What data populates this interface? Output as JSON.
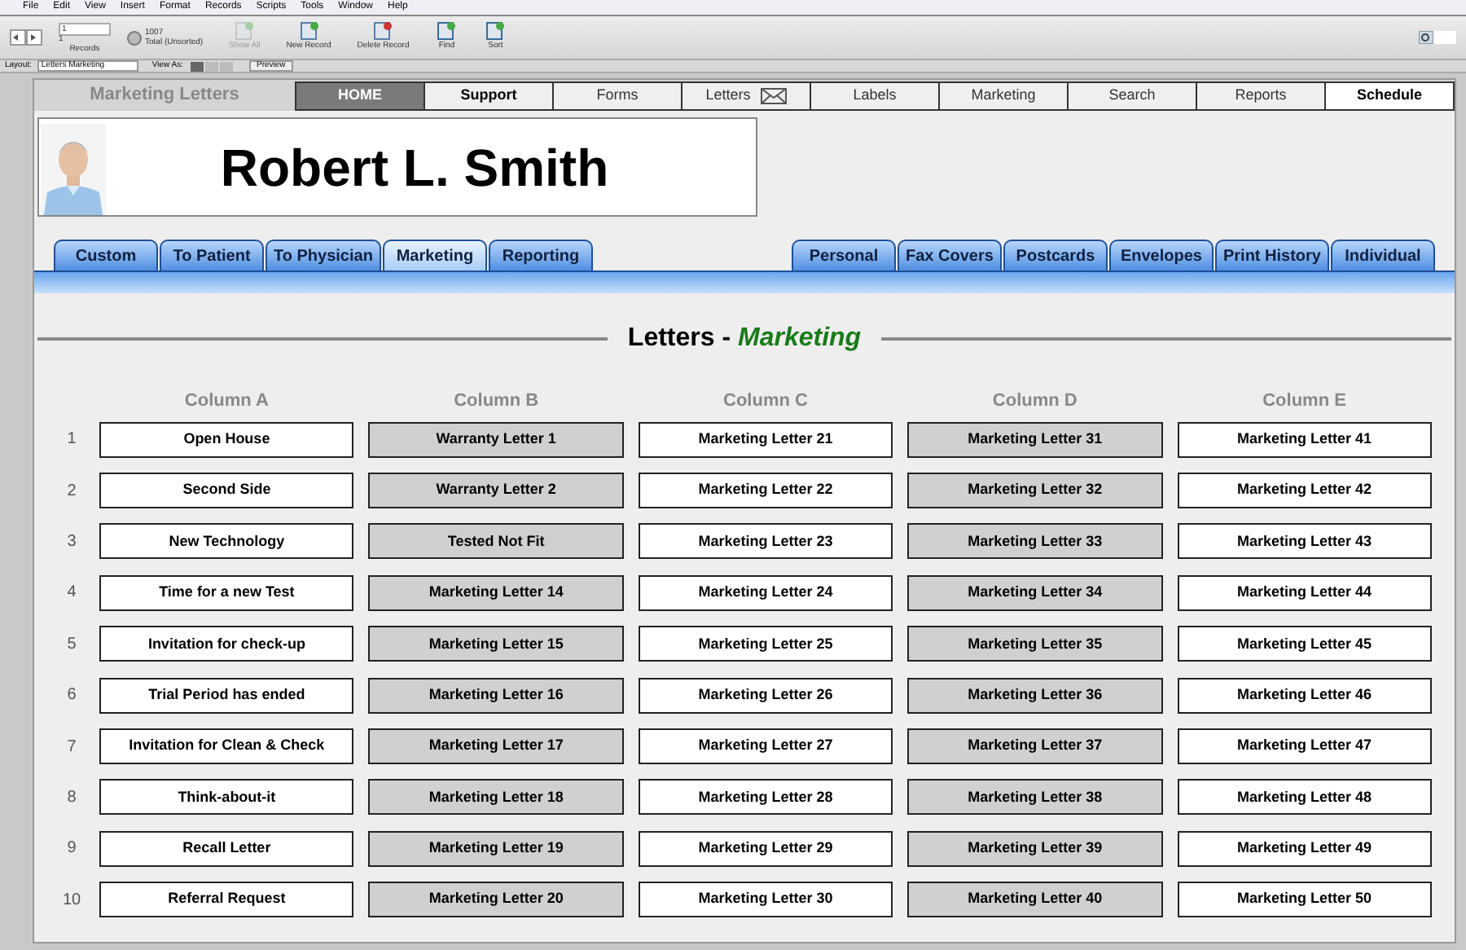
{
  "menu": [
    "File",
    "Edit",
    "View",
    "Insert",
    "Format",
    "Records",
    "Scripts",
    "Tools",
    "Window",
    "Help"
  ],
  "toolbar": {
    "record_field": "1",
    "record_sub": "1",
    "records_label": "Records",
    "total": "1007",
    "total_label": "Total (Unsorted)",
    "buttons": [
      {
        "label": "Show All",
        "disabled": true
      },
      {
        "label": "New Record",
        "disabled": false
      },
      {
        "label": "Delete Record",
        "disabled": false
      },
      {
        "label": "Find",
        "disabled": false
      },
      {
        "label": "Sort",
        "disabled": false
      }
    ]
  },
  "layout_bar": {
    "layout_label": "Layout:",
    "layout_value": "Letters Marketing",
    "view_as_label": "View As:",
    "preview": "Preview"
  },
  "page_title": "Marketing Letters",
  "nav": [
    {
      "label": "HOME",
      "kind": "dark"
    },
    {
      "label": "Support",
      "kind": "bold"
    },
    {
      "label": "Forms",
      "kind": "plain"
    },
    {
      "label": "Letters",
      "kind": "mail"
    },
    {
      "label": "Labels",
      "kind": "plain"
    },
    {
      "label": "Marketing",
      "kind": "plain"
    },
    {
      "label": "Search",
      "kind": "plain"
    },
    {
      "label": "Reports",
      "kind": "plain"
    },
    {
      "label": "Schedule",
      "kind": "white"
    }
  ],
  "patient_name": "Robert L. Smith",
  "tabs_left": [
    {
      "label": "Custom",
      "selected": false
    },
    {
      "label": "To Patient",
      "selected": false
    },
    {
      "label": "To Physician",
      "selected": false
    },
    {
      "label": "Marketing",
      "selected": true
    },
    {
      "label": "Reporting",
      "selected": false
    }
  ],
  "tabs_right": [
    {
      "label": "Personal",
      "selected": false
    },
    {
      "label": "Fax Covers",
      "selected": false
    },
    {
      "label": "Postcards",
      "selected": false
    },
    {
      "label": "Envelopes",
      "selected": false
    },
    {
      "label": "Print History",
      "selected": false
    },
    {
      "label": "Individual",
      "selected": false
    }
  ],
  "heading": {
    "prefix": "Letters -",
    "category": "Marketing"
  },
  "columns": [
    {
      "title": "Column A",
      "shaded": false,
      "items": [
        "Open House",
        "Second Side",
        "New Technology",
        "Time for a new Test",
        "Invitation for check-up",
        "Trial Period has ended",
        "Invitation for Clean & Check",
        "Think-about-it",
        "Recall Letter",
        "Referral Request"
      ]
    },
    {
      "title": "Column B",
      "shaded": true,
      "items": [
        "Warranty Letter 1",
        "Warranty Letter 2",
        "Tested Not Fit",
        "Marketing Letter 14",
        "Marketing Letter 15",
        "Marketing Letter 16",
        "Marketing Letter 17",
        "Marketing Letter 18",
        "Marketing Letter 19",
        "Marketing Letter 20"
      ]
    },
    {
      "title": "Column C",
      "shaded": false,
      "items": [
        "Marketing Letter 21",
        "Marketing Letter 22",
        "Marketing Letter 23",
        "Marketing Letter 24",
        "Marketing Letter 25",
        "Marketing Letter 26",
        "Marketing Letter 27",
        "Marketing Letter 28",
        "Marketing Letter 29",
        "Marketing Letter 30"
      ]
    },
    {
      "title": "Column D",
      "shaded": true,
      "items": [
        "Marketing Letter 31",
        "Marketing Letter 32",
        "Marketing Letter 33",
        "Marketing Letter 34",
        "Marketing Letter 35",
        "Marketing Letter 36",
        "Marketing Letter 37",
        "Marketing Letter 38",
        "Marketing Letter 39",
        "Marketing Letter 40"
      ]
    },
    {
      "title": "Column E",
      "shaded": false,
      "items": [
        "Marketing Letter 41",
        "Marketing Letter 42",
        "Marketing Letter 43",
        "Marketing Letter 44",
        "Marketing Letter 45",
        "Marketing Letter 46",
        "Marketing Letter 47",
        "Marketing Letter 48",
        "Marketing Letter 49",
        "Marketing Letter 50"
      ]
    }
  ],
  "row_numbers": [
    "1",
    "2",
    "3",
    "4",
    "5",
    "6",
    "7",
    "8",
    "9",
    "10"
  ]
}
